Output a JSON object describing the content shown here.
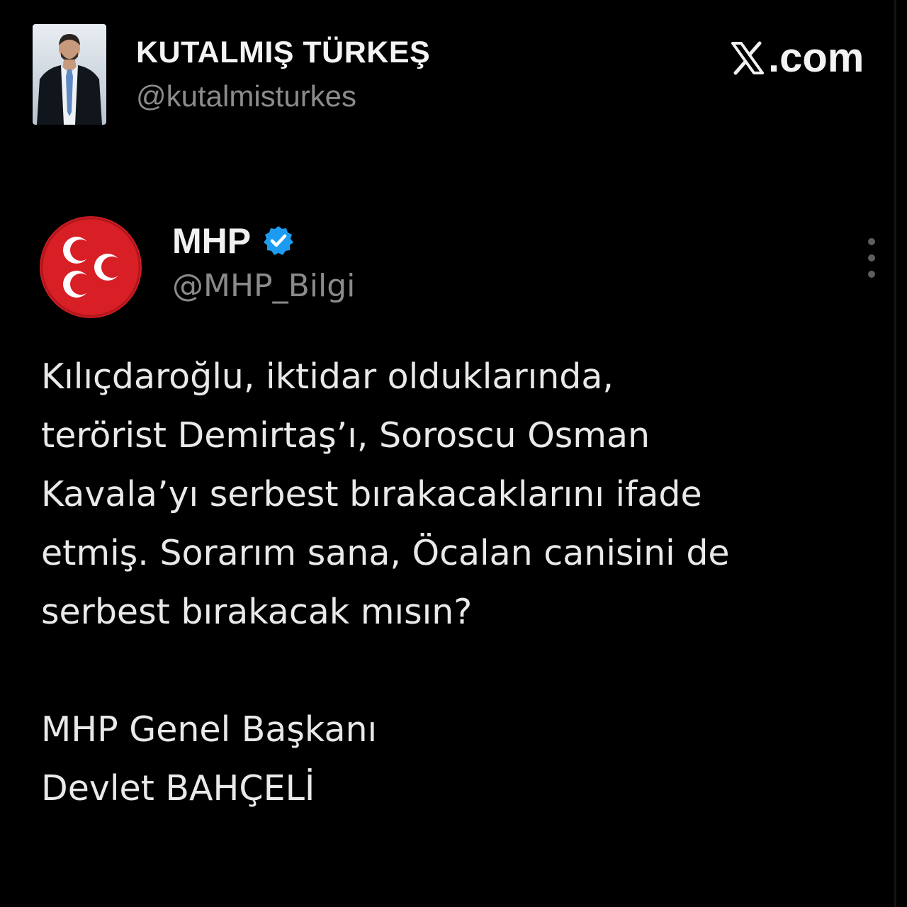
{
  "header": {
    "poster_name": "KUTALMIŞ TÜRKEŞ",
    "poster_handle": "@kutalmisturkes",
    "brand_text": ".com",
    "brand_icon": "x-logo-icon"
  },
  "tweet": {
    "author_name": "MHP",
    "author_handle": "@MHP_Bilgi",
    "verified_icon": "verified-badge-icon",
    "verified_color": "#1d9bf0",
    "logo_color": "#d81f26",
    "more_icon": "more-options-icon",
    "body_lines": [
      "Kılıçdaroğlu, iktidar olduklarında,",
      "terörist Demirtaş’ı, Soroscu Osman",
      "Kavala’yı serbest bırakacaklarını ifade",
      "etmiş. Sorarım sana, Öcalan canisini de",
      "serbest bırakacak mısın?"
    ],
    "signature_lines": [
      "MHP Genel Başkanı",
      "Devlet BAHÇELİ"
    ]
  },
  "colors": {
    "background": "#000000",
    "text_primary": "#e9e9e9",
    "text_secondary": "#8a8a8a"
  }
}
